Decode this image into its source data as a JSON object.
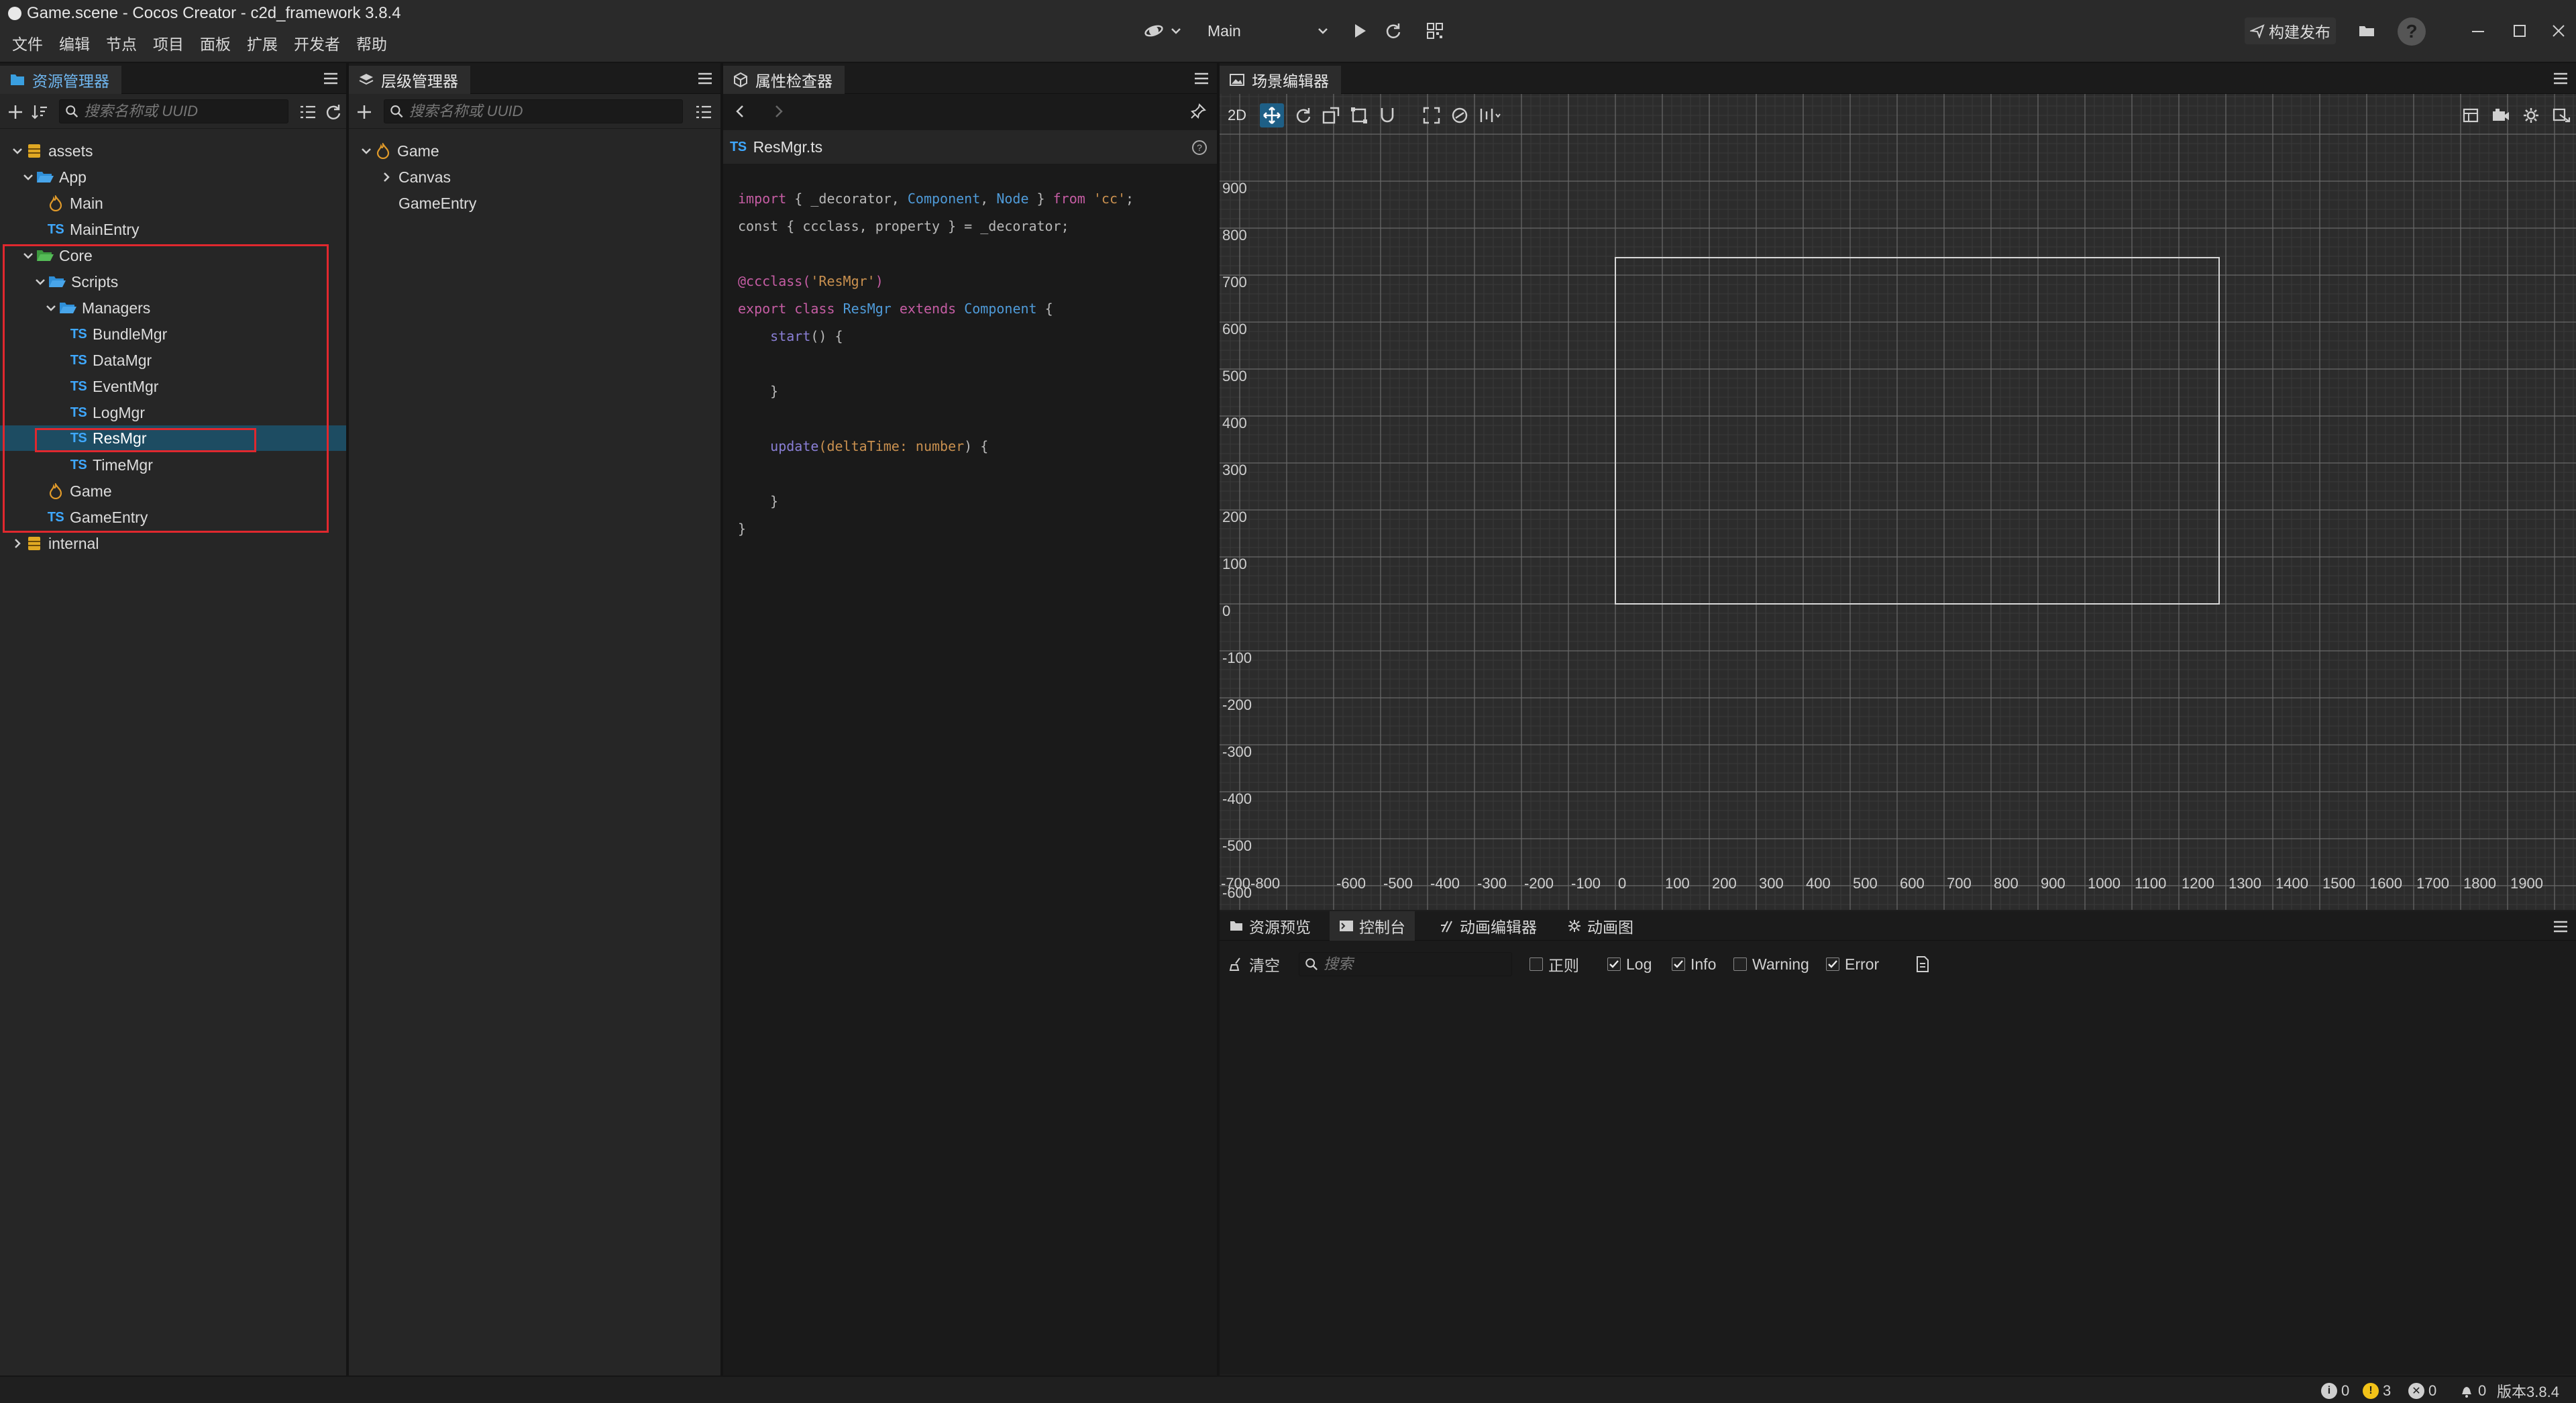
{
  "window": {
    "title": "Game.scene - Cocos Creator - c2d_framework 3.8.4"
  },
  "menu": [
    "文件",
    "编辑",
    "节点",
    "项目",
    "面板",
    "扩展",
    "开发者",
    "帮助"
  ],
  "toolbar": {
    "scene_select": "Main",
    "build_label": "构建发布"
  },
  "assets_panel": {
    "tab": "资源管理器",
    "search_placeholder": "搜索名称或 UUID",
    "tree": [
      {
        "label": "assets",
        "icon": "database-icon"
      },
      {
        "label": "App",
        "icon": "folder-open-icon"
      },
      {
        "label": "Main",
        "icon": "scene-fire-icon"
      },
      {
        "label": "MainEntry",
        "icon": "ts-icon"
      },
      {
        "label": "Core",
        "icon": "folder-open-green-icon"
      },
      {
        "label": "Scripts",
        "icon": "folder-open-icon"
      },
      {
        "label": "Managers",
        "icon": "folder-open-icon"
      },
      {
        "label": "BundleMgr",
        "icon": "ts-icon"
      },
      {
        "label": "DataMgr",
        "icon": "ts-icon"
      },
      {
        "label": "EventMgr",
        "icon": "ts-icon"
      },
      {
        "label": "LogMgr",
        "icon": "ts-icon"
      },
      {
        "label": "ResMgr",
        "icon": "ts-icon"
      },
      {
        "label": "TimeMgr",
        "icon": "ts-icon"
      },
      {
        "label": "Game",
        "icon": "scene-fire-icon"
      },
      {
        "label": "GameEntry",
        "icon": "ts-icon"
      },
      {
        "label": "internal",
        "icon": "database-icon"
      }
    ]
  },
  "hierarchy_panel": {
    "tab": "层级管理器",
    "search_placeholder": "搜索名称或 UUID",
    "tree": [
      {
        "label": "Game"
      },
      {
        "label": "Canvas"
      },
      {
        "label": "GameEntry"
      }
    ]
  },
  "inspector_panel": {
    "tab": "属性检查器",
    "file_name": "ResMgr.ts",
    "file_icon": "TS",
    "code": {
      "l1_a": "import",
      "l1_b": " { _decorator, ",
      "l1_c": "Component",
      "l1_d": ", ",
      "l1_e": "Node",
      "l1_f": " } ",
      "l1_g": "from",
      "l1_h": " ",
      "l1_i": "'cc'",
      "l1_j": ";",
      "l2": "const { ccclass, property } = _decorator;",
      "l4_a": "@ccclass(",
      "l4_b": "'ResMgr'",
      "l4_c": ")",
      "l5_a": "export",
      "l5_b": " ",
      "l5_c": "class",
      "l5_d": " ",
      "l5_e": "ResMgr",
      "l5_f": " ",
      "l5_g": "extends",
      "l5_h": " ",
      "l5_i": "Component",
      "l5_j": " {",
      "l6_a": "    start",
      "l6_b": "() {",
      "l8": "    }",
      "l10_a": "    update",
      "l10_b": "(deltaTime: ",
      "l10_c": "number",
      "l10_d": ") {",
      "l12": "    }",
      "l13": "}"
    }
  },
  "scene_panel": {
    "tab": "场景编辑器",
    "mode_2d": "2D",
    "y_labels": [
      "900",
      "800",
      "700",
      "600",
      "500",
      "400",
      "300",
      "200",
      "100",
      "0",
      "-100",
      "-200",
      "-300",
      "-400",
      "-500",
      "-600"
    ],
    "x_labels": [
      "-700",
      "-600",
      "-500",
      "-400",
      "-300",
      "-200",
      "-100",
      "0",
      "100",
      "200",
      "300",
      "400",
      "500",
      "600",
      "700",
      "800",
      "900",
      "1000",
      "1100",
      "1200",
      "1300",
      "1400",
      "1500",
      "1600",
      "1700",
      "1800",
      "1900"
    ],
    "x_first_label": "-700-800"
  },
  "console_panel": {
    "tabs": [
      {
        "label": "资源预览",
        "icon": "folder-icon"
      },
      {
        "label": "控制台",
        "icon": "console-icon"
      },
      {
        "label": "动画编辑器",
        "icon": "animation-icon"
      },
      {
        "label": "动画图",
        "icon": "graph-icon"
      }
    ],
    "clear_label": "清空",
    "search_placeholder": "搜索",
    "filters": [
      {
        "label": "正则",
        "checked": false
      },
      {
        "label": "Log",
        "checked": true
      },
      {
        "label": "Info",
        "checked": true
      },
      {
        "label": "Warning",
        "checked": false
      },
      {
        "label": "Error",
        "checked": true
      }
    ]
  },
  "statusbar": {
    "info_count": "0",
    "warn_count": "3",
    "error_count": "0",
    "notif_count": "0",
    "version": "版本3.8.4"
  },
  "colors": {
    "accent": "#2d6fb0",
    "selected_row": "#1c4f66",
    "highlight_box": "#e0282e",
    "ts_blue": "#3fa8ff",
    "folder_blue": "#2f8fd8",
    "folder_green": "#48b04a"
  }
}
